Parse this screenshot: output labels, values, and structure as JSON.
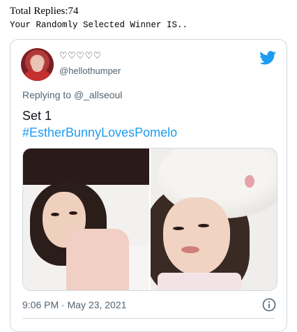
{
  "header": {
    "total_replies_label": "Total Replies:",
    "total_replies_count": "74",
    "winner_text": "Your Randomly Selected Winner IS.."
  },
  "tweet": {
    "display_name": "♡♡♡♡♡",
    "handle": "@hellothumper",
    "reply_prefix": "Replying to ",
    "reply_user": "@_allseoul",
    "text_line1": "Set 1",
    "hashtag": "#EstherBunnyLovesPomelo",
    "timestamp": "9:06 PM · May 23, 2021",
    "icons": {
      "brand": "twitter-bird-icon",
      "info": "info-icon"
    },
    "colors": {
      "brand": "#1d9bf0",
      "secondary_text": "#536471",
      "hashtag": "#1d9bf0"
    }
  }
}
